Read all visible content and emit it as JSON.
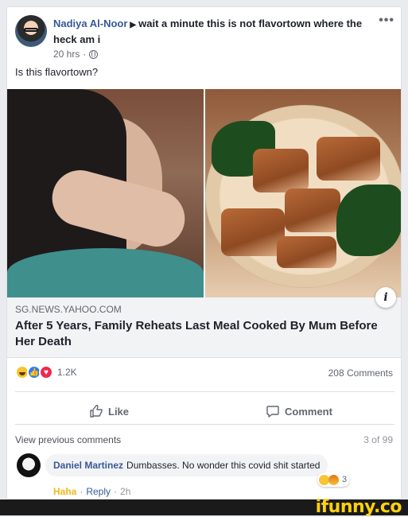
{
  "post": {
    "author": "Nadiya Al-Noor",
    "group": "wait a minute this is not flavortown where the heck am i",
    "time": "20 hrs",
    "text": "Is this flavortown?",
    "more_icon": "more-dots-icon"
  },
  "link": {
    "domain": "SG.NEWS.YAHOO.COM",
    "title": "After 5 Years, Family Reheats Last Meal Cooked By Mum Before Her Death",
    "info_icon": "i"
  },
  "stats": {
    "reaction_count": "1.2K",
    "comments": "208 Comments"
  },
  "actions": {
    "like": "Like",
    "comment": "Comment"
  },
  "comments_section": {
    "view_previous": "View previous comments",
    "page": "3 of 99",
    "comment": {
      "author": "Daniel Martinez",
      "text": "Dumbasses. No wonder this covid shit started",
      "reaction_count": "3",
      "haha": "Haha",
      "reply": "Reply",
      "sep1": "·",
      "sep2": "·",
      "time": "2h"
    }
  },
  "watermark": "ifunny.co",
  "colors": {
    "link_blue": "#365899",
    "haha_yellow": "#f0ba15",
    "ifunny_yellow": "#ffd20a"
  }
}
